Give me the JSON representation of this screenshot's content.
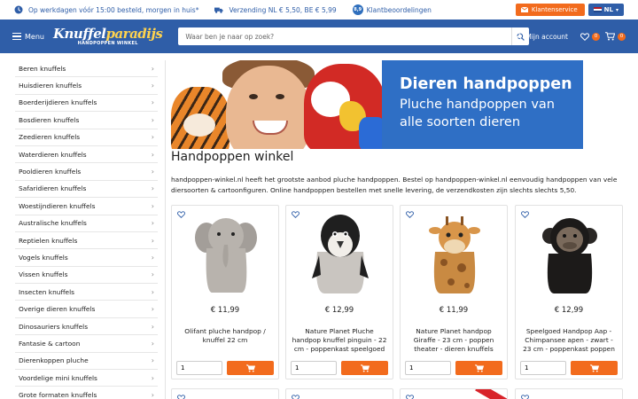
{
  "topbar": {
    "delivery": "Op werkdagen vóór 15:00 besteld, morgen in huis*",
    "shipping": "Verzending NL € 5,50, BE € 5,99",
    "rating_score": "8,9",
    "reviews": "Klantbeoordelingen",
    "service_label": "Klantenservice",
    "language": "NL"
  },
  "header": {
    "menu_label": "Menu",
    "logo_part1": "Knuffel",
    "logo_part2": "paradijs",
    "logo_tagline": "HANDPOPPEN WINKEL",
    "search_placeholder": "Waar ben je naar op zoek?",
    "account_label": "Mijn account",
    "wishlist_count": "0",
    "cart_count": "0"
  },
  "sidebar": {
    "categories": [
      "Beren knuffels",
      "Huisdieren knuffels",
      "Boerderijdieren knuffels",
      "Bosdieren knuffels",
      "Zeedieren knuffels",
      "Waterdieren knuffels",
      "Pooldieren knuffels",
      "Safaridieren knuffels",
      "Woestijndieren knuffels",
      "Australische knuffels",
      "Reptielen knuffels",
      "Vogels knuffels",
      "Vissen knuffels",
      "Insecten knuffels",
      "Overige dieren knuffels",
      "Dinosauriers knuffels",
      "Fantasie & cartoon",
      "Dierenkoppen pluche",
      "Voordelige mini knuffels",
      "Grote formaten knuffels"
    ]
  },
  "banner": {
    "title": "Dieren handpoppen",
    "subtitle": "Pluche handpoppen van alle soorten dieren"
  },
  "main": {
    "title": "Handpoppen winkel",
    "intro": "handpoppen-winkel.nl heeft het grootste aanbod pluche handpoppen. Bestel op handpoppen-winkel.nl eenvoudig handpoppen van vele diersoorten & cartoonfiguren. Online handpoppen bestellen met snelle levering, de verzendkosten zijn slechts slechts 5,50."
  },
  "products": [
    {
      "price": "€ 11,99",
      "name": "Olifant pluche handpop / knuffel 22 cm",
      "qty": "1",
      "icon": "elephant-puppet"
    },
    {
      "price": "€ 12,99",
      "name": "Nature Planet Pluche handpop knuffel pinguin - 22 cm - poppenkast speelgoed",
      "qty": "1",
      "icon": "penguin-puppet"
    },
    {
      "price": "€ 11,99",
      "name": "Nature Planet handpop Giraffe - 23 cm - poppen theater - dieren knuffels",
      "qty": "1",
      "icon": "giraffe-puppet"
    },
    {
      "price": "€ 12,99",
      "name": "Speelgoed Handpop Aap - Chimpansee apen - zwart - 23 cm - poppenkast poppen",
      "qty": "1",
      "icon": "chimpanzee-puppet"
    }
  ],
  "colors": {
    "brand_blue": "#2f5ea8",
    "accent_orange": "#f26b1d",
    "banner_blue": "#2f6fc5"
  }
}
